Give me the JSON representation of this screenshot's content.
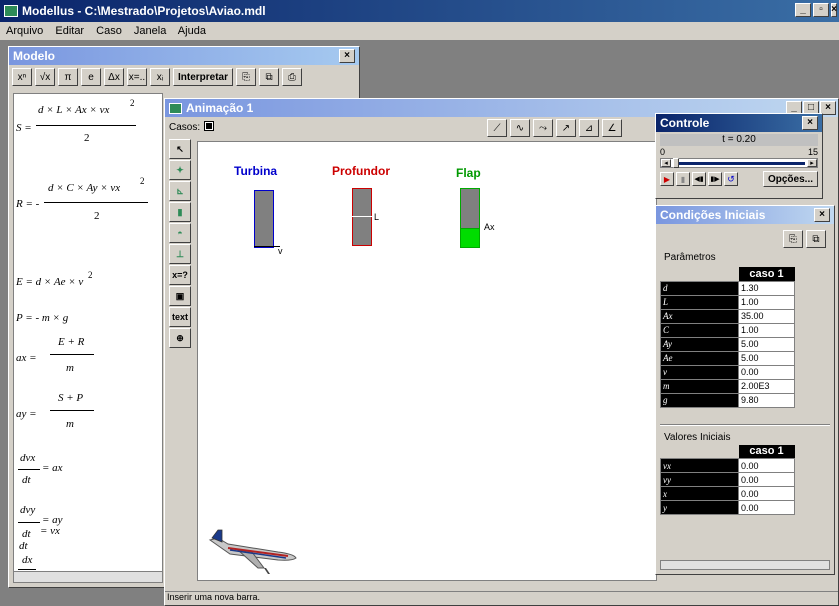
{
  "app": {
    "title": "Modellus - C:\\Mestrado\\Projetos\\Aviao.mdl"
  },
  "menu": [
    "Arquivo",
    "Editar",
    "Caso",
    "Janela",
    "Ajuda"
  ],
  "modelo": {
    "title": "Modelo",
    "toolbar": {
      "sup": "xⁿ",
      "sqrt": "√x",
      "pi": "π",
      "e": "e",
      "dx": "Δx",
      "xeq": "x=..",
      "idx": "xᵢ",
      "interpret": "Interpretar"
    },
    "equations": {
      "S_lhs": "S =",
      "S_num": "d × L × Ax × vx",
      "S_exp": "2",
      "S_den": "2",
      "R_lhs": "R = -",
      "R_num": "d × C × Ay × vx",
      "R_exp": "2",
      "R_den": "2",
      "E_eq": "E = d × Ae × v",
      "E_exp": "2",
      "P_eq": "P = - m × g",
      "ax_lhs": "ax =",
      "ax_num": "E + R",
      "ax_den": "m",
      "ay_lhs": "ay =",
      "ay_num": "S + P",
      "ay_den": "m",
      "dvx_num": "dvx",
      "dvx_rhs": "= ax",
      "dvx_den": "dt",
      "dvy_num": "dvy",
      "dvy_rhs": "= ay",
      "dvy_den": "dt",
      "dx_num": "dx",
      "dx_rhs": "= vx",
      "dx_den": "dt"
    }
  },
  "animacao": {
    "title": "Animação 1",
    "casos_label": "Casos:",
    "tools": {
      "text": "text",
      "xq": "x=?"
    },
    "bars": [
      {
        "title": "Turbina",
        "color": "#0000cc",
        "mark": "v",
        "fill": 0.0
      },
      {
        "title": "Profundor",
        "color": "#cc0000",
        "mark": "L",
        "fill": 0.5
      },
      {
        "title": "Flap",
        "color": "#00aa00",
        "mark": "Ax",
        "fill": 0.35
      }
    ],
    "status": "Inserir uma nova barra."
  },
  "controle": {
    "title": "Controle",
    "t_label": "t = 0.20",
    "min": "0",
    "max": "15",
    "progress": 0.013,
    "opcoes": "Opções..."
  },
  "cond": {
    "title": "Condições Iniciais",
    "param_label": "Parâmetros",
    "caso": "caso 1",
    "params": [
      {
        "n": "d",
        "v": "1.30"
      },
      {
        "n": "L",
        "v": "1.00"
      },
      {
        "n": "Ax",
        "v": "35.00"
      },
      {
        "n": "C",
        "v": "1.00"
      },
      {
        "n": "Ay",
        "v": "5.00"
      },
      {
        "n": "Ae",
        "v": "5.00"
      },
      {
        "n": "v",
        "v": "0.00"
      },
      {
        "n": "m",
        "v": "2.00E3"
      },
      {
        "n": "g",
        "v": "9.80"
      }
    ],
    "init_label": "Valores Iniciais",
    "init": [
      {
        "n": "vx",
        "v": "0.00"
      },
      {
        "n": "vy",
        "v": "0.00"
      },
      {
        "n": "x",
        "v": "0.00"
      },
      {
        "n": "y",
        "v": "0.00"
      }
    ]
  }
}
